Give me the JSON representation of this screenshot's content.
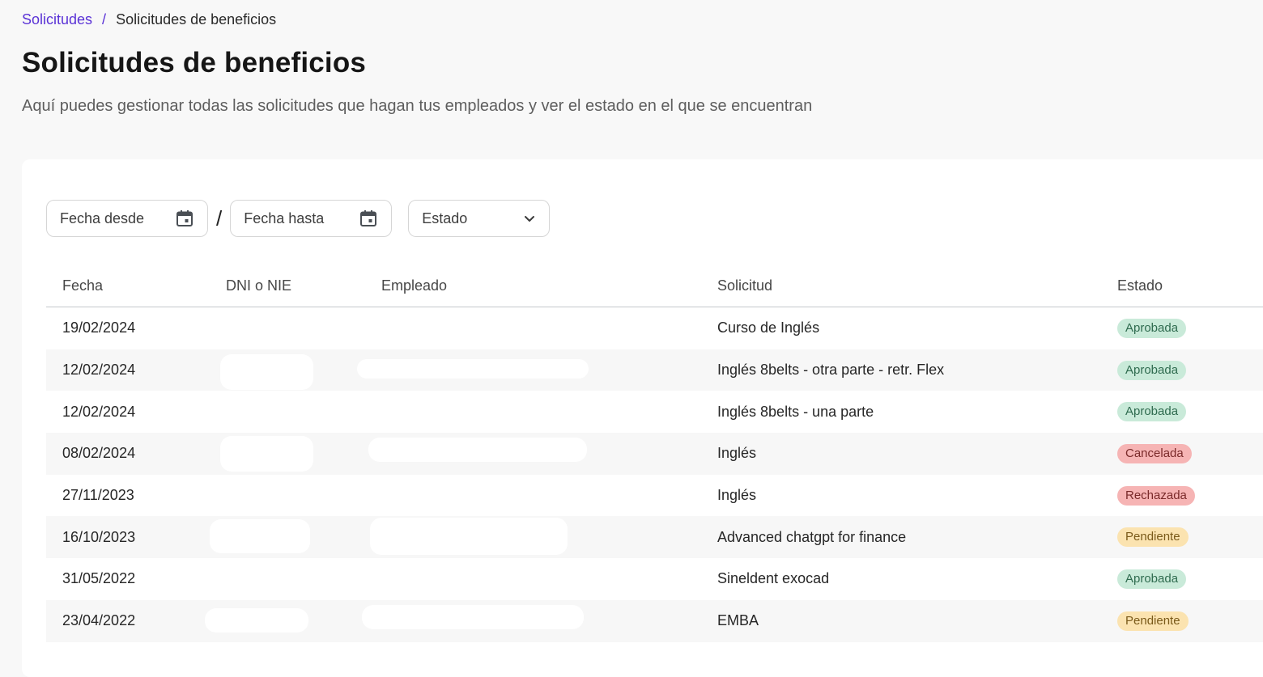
{
  "breadcrumb": {
    "parent": "Solicitudes",
    "separator": "/",
    "current": "Solicitudes de beneficios"
  },
  "header": {
    "title": "Solicitudes de beneficios",
    "subtitle": "Aquí puedes gestionar todas las solicitudes que hagan tus empleados y ver el estado en el que se encuentran"
  },
  "filters": {
    "date_from_placeholder": "Fecha desde",
    "range_separator": "/",
    "date_to_placeholder": "Fecha hasta",
    "status_placeholder": "Estado"
  },
  "table": {
    "columns": [
      "Fecha",
      "DNI o NIE",
      "Empleado",
      "Solicitud",
      "Estado"
    ],
    "rows": [
      {
        "fecha": "19/02/2024",
        "dni": "",
        "empleado": "",
        "solicitud": "Curso de Inglés",
        "estado": "Aprobada"
      },
      {
        "fecha": "12/02/2024",
        "dni": "",
        "empleado": "",
        "solicitud": "Inglés 8belts - otra parte - retr. Flex",
        "estado": "Aprobada"
      },
      {
        "fecha": "12/02/2024",
        "dni": "",
        "empleado": "",
        "solicitud": "Inglés 8belts - una parte",
        "estado": "Aprobada"
      },
      {
        "fecha": "08/02/2024",
        "dni": "",
        "empleado": "",
        "solicitud": "Inglés",
        "estado": "Cancelada"
      },
      {
        "fecha": "27/11/2023",
        "dni": "",
        "empleado": "",
        "solicitud": "Inglés",
        "estado": "Rechazada"
      },
      {
        "fecha": "16/10/2023",
        "dni": "",
        "empleado": "",
        "solicitud": "Advanced chatgpt for finance",
        "estado": "Pendiente"
      },
      {
        "fecha": "31/05/2022",
        "dni": "",
        "empleado": "",
        "solicitud": "Sineldent exocad",
        "estado": "Aprobada"
      },
      {
        "fecha": "23/04/2022",
        "dni": "",
        "empleado": "",
        "solicitud": "EMBA",
        "estado": "Pendiente"
      }
    ]
  },
  "status_colors": {
    "Aprobada": {
      "bg": "#c9ead9",
      "fg": "#2f6b4f"
    },
    "Cancelada": {
      "bg": "#f6b4b4",
      "fg": "#7a2a2a"
    },
    "Rechazada": {
      "bg": "#f6b4b4",
      "fg": "#7a2a2a"
    },
    "Pendiente": {
      "bg": "#fbe3b0",
      "fg": "#7a5a1a"
    }
  },
  "icons": {
    "date_from": "calendar-icon",
    "date_to": "calendar-icon",
    "status": "chevron-down-icon"
  }
}
